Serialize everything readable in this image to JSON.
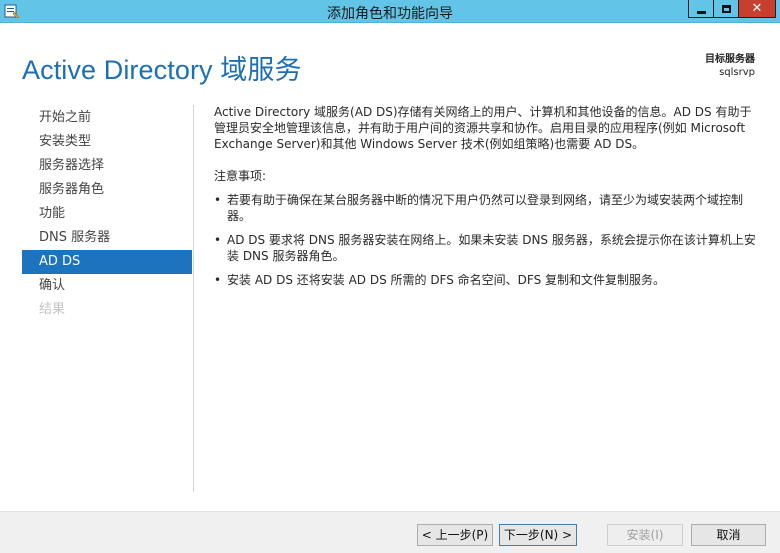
{
  "window": {
    "title": "添加角色和功能向导",
    "minimize_icon": "minimize-icon",
    "maximize_icon": "maximize-icon",
    "close_glyph": "✕"
  },
  "header": {
    "title": "Active Directory 域服务",
    "target_label": "目标服务器",
    "target_server": "sqlsrvp"
  },
  "nav": {
    "items": [
      {
        "label": "开始之前",
        "state": "normal"
      },
      {
        "label": "安装类型",
        "state": "normal"
      },
      {
        "label": "服务器选择",
        "state": "normal"
      },
      {
        "label": "服务器角色",
        "state": "normal"
      },
      {
        "label": "功能",
        "state": "normal"
      },
      {
        "label": "DNS 服务器",
        "state": "normal"
      },
      {
        "label": "AD DS",
        "state": "active"
      },
      {
        "label": "确认",
        "state": "normal"
      },
      {
        "label": "结果",
        "state": "disabled"
      }
    ]
  },
  "content": {
    "intro": "Active Directory 域服务(AD DS)存储有关网络上的用户、计算机和其他设备的信息。AD DS 有助于管理员安全地管理该信息，并有助于用户间的资源共享和协作。启用目录的应用程序(例如 Microsoft Exchange Server)和其他 Windows Server 技术(例如组策略)也需要 AD DS。",
    "notice_label": "注意事项:",
    "bullets": [
      "若要有助于确保在某台服务器中断的情况下用户仍然可以登录到网络，请至少为域安装两个域控制器。",
      "AD DS 要求将 DNS 服务器安装在网络上。如果未安装 DNS 服务器，系统会提示你在该计算机上安装 DNS 服务器角色。",
      "安装 AD DS 还将安装 AD DS 所需的 DFS 命名空间、DFS 复制和文件复制服务。"
    ]
  },
  "footer": {
    "prev_label": "< 上一步(P)",
    "next_label": "下一步(N) >",
    "install_label": "安装(I)",
    "cancel_label": "取消"
  },
  "colors": {
    "titlebar": "#62c5e7",
    "accent": "#1e73be",
    "heading": "#1c6fb5",
    "close": "#c7402f"
  }
}
